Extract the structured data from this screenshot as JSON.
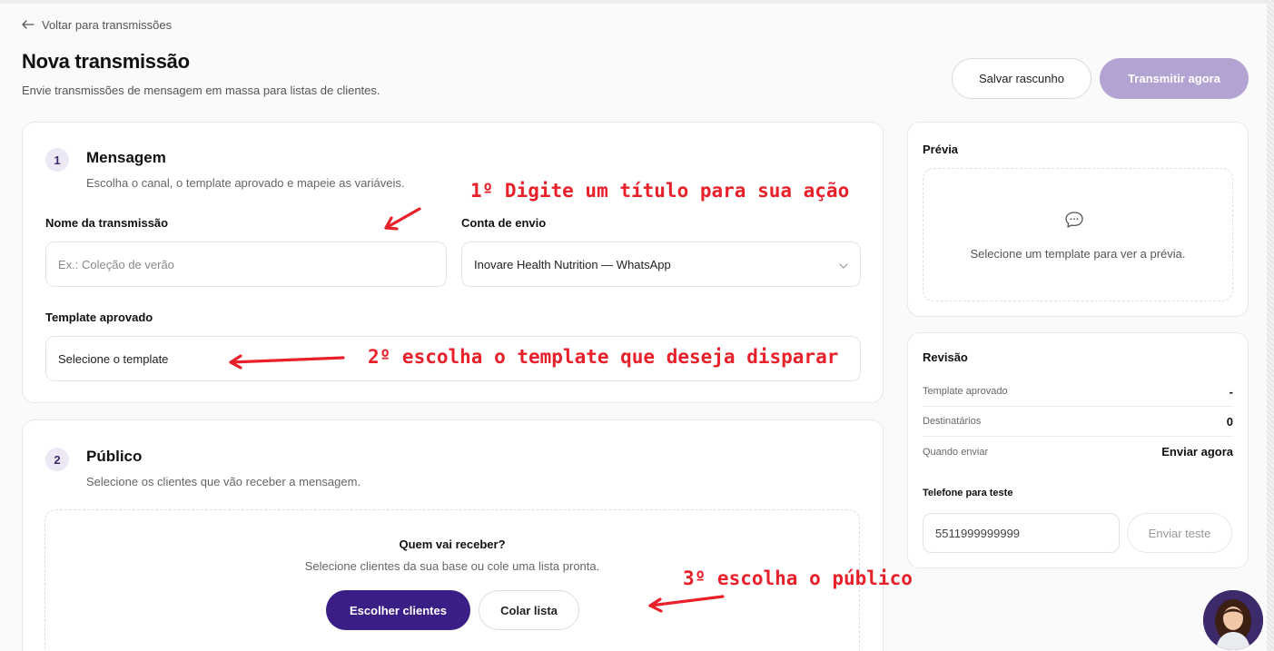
{
  "header": {
    "back_label": "Voltar para transmissões",
    "title": "Nova transmissão",
    "subtitle": "Envie transmissões de mensagem em massa para listas de clientes.",
    "save_draft_label": "Salvar rascunho",
    "send_now_label": "Transmitir agora"
  },
  "message_section": {
    "step": "1",
    "title": "Mensagem",
    "subtitle": "Escolha o canal, o template aprovado e mapeie as variáveis.",
    "name_label": "Nome da transmissão",
    "name_placeholder": "Ex.: Coleção de verão",
    "account_label": "Conta de envio",
    "account_value": "Inovare Health Nutrition — WhatsApp",
    "template_label": "Template aprovado",
    "template_value": "Selecione o template"
  },
  "audience_section": {
    "step": "2",
    "title": "Público",
    "subtitle": "Selecione os clientes que vão receber a mensagem.",
    "who_title": "Quem vai receber?",
    "who_subtitle": "Selecione clientes da sua base ou cole uma lista pronta.",
    "choose_label": "Escolher clientes",
    "paste_label": "Colar lista"
  },
  "preview": {
    "title": "Prévia",
    "empty_text": "Selecione um template para ver a prévia."
  },
  "review": {
    "title": "Revisão",
    "rows": [
      {
        "key": "Template aprovado",
        "value": "-"
      },
      {
        "key": "Destinatários",
        "value": "0"
      },
      {
        "key": "Quando enviar",
        "value": "Enviar agora"
      }
    ],
    "phone_label": "Telefone para teste",
    "phone_placeholder": "5511999999999",
    "test_button_label": "Enviar teste"
  },
  "annotations": {
    "step1": "1º Digite um título para sua ação",
    "step2": "2º escolha o template que deseja disparar",
    "step3": "3º escolha o público"
  },
  "colors": {
    "accent": "#3b1d86",
    "accent_disabled": "#b3a3d3",
    "annotation": "#e8202a"
  },
  "icons": {
    "back": "arrow-left-icon",
    "chevron": "chevron-down-icon",
    "preview": "chat-bubble-icon"
  }
}
